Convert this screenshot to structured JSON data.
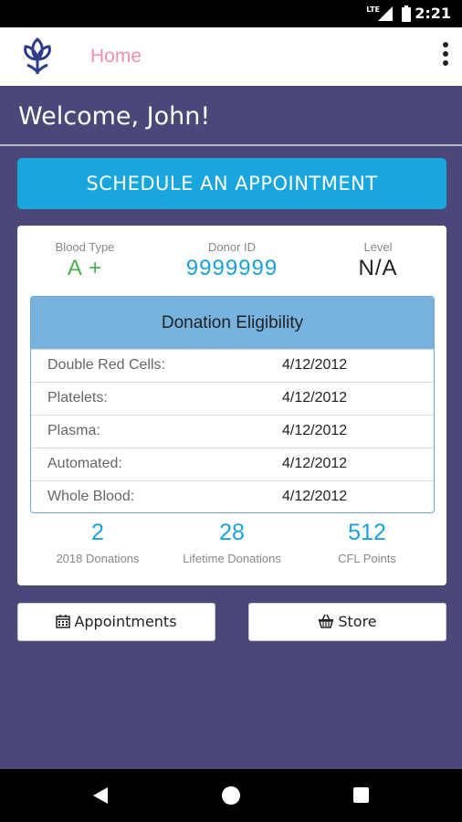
{
  "status": {
    "time": "2:21",
    "network": "LTE"
  },
  "appbar": {
    "title": "Home"
  },
  "welcome": "Welcome, John!",
  "schedule_label": "SCHEDULE AN APPOINTMENT",
  "donor": {
    "blood_type_label": "Blood Type",
    "blood_type": "A +",
    "donor_id_label": "Donor ID",
    "donor_id": "9999999",
    "level_label": "Level",
    "level": "N/A"
  },
  "eligibility": {
    "title": "Donation Eligibility",
    "rows": [
      {
        "label": "Double Red Cells:",
        "date": "4/12/2012"
      },
      {
        "label": "Platelets:",
        "date": "4/12/2012"
      },
      {
        "label": "Plasma:",
        "date": "4/12/2012"
      },
      {
        "label": "Automated:",
        "date": "4/12/2012"
      },
      {
        "label": "Whole Blood:",
        "date": "4/12/2012"
      }
    ]
  },
  "stats": [
    {
      "value": "2",
      "caption": "2018 Donations"
    },
    {
      "value": "28",
      "caption": "Lifetime Donations"
    },
    {
      "value": "512",
      "caption": "CFL Points"
    }
  ],
  "buttons": {
    "appointments": "Appointments",
    "store": "Store"
  },
  "colors": {
    "accent": "#18a6dd",
    "background": "#4a4878",
    "blood_type": "#4caf50",
    "home_title": "#f48fb1"
  }
}
